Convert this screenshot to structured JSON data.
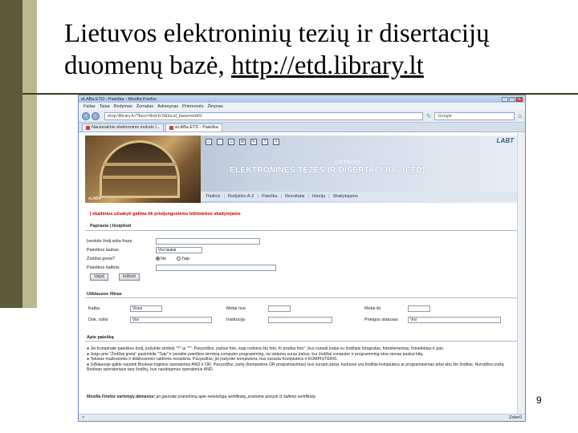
{
  "slide": {
    "title_line1": "Lietuvos elektroninių tezių ir disertacijų",
    "title_line2_prefix": "duomenų bazė, ",
    "title_url": "http://etd.library.lt",
    "page_number": "9"
  },
  "browser": {
    "window_title": "eLABa ETD - Paieška - Mozilla Firefox",
    "menu": [
      "Failas",
      "Taisa",
      "Rodymas",
      "Žurnalas",
      "Adresynas",
      "Priemonės",
      "Žinynas"
    ],
    "url": "etop:\\library.lt:/?func=find-b-0&local_base=etd01",
    "search_placeholder": "Google",
    "tabs": [
      {
        "label": "Nacionalinis elektroninis mokslo l...",
        "active": false
      },
      {
        "label": "eLABa ETD - Paieška",
        "active": true
      }
    ],
    "status_left": "×",
    "status_right": "Zoter0"
  },
  "site": {
    "photo_label": "eLABA",
    "logo": "LABT",
    "subtitle": "LIETUVOS",
    "title": "ELEKTRONINĖS TEZĖS IR DISERTACIJOS (ETD)",
    "nav": [
      "Titulinis",
      "Rodyklės A-Z",
      "Paieška",
      "Rezultatai",
      "Istorija",
      "Skaitytojams"
    ]
  },
  "content": {
    "notice": "Į skaitinius užsakyti galima tik prisijungusiems bibliotekos skaitytojams",
    "subtabs": "Paprasta | Išsiplėsti",
    "form": {
      "query_label": "Įveskite žodį arba frazę",
      "field_label": "Paieškos laukas",
      "field_value": "Visi laukai",
      "adjacent_label": "Žodžiai greta?",
      "radio_no": "Ne",
      "radio_yes": "Taip",
      "base_label": "Paieškos šaltinis",
      "btn_clear": "Valyti",
      "btn_search": "Ieškoti"
    },
    "filters": {
      "heading": "Užklausos filtras",
      "lang_label": "Kalba",
      "lang_value": "Visos",
      "year_from_label": "Metai nuo",
      "year_to_label": "Metai iki",
      "doctype_label": "Dok. rūšis",
      "doctype_value": "Visi",
      "institution_label": "Institucija",
      "status_label": "Prieigos statusas",
      "status_value": "Visi"
    },
    "help": {
      "heading": "Apie paiešką",
      "line1": "● Jei trumpinate paieškos žodį, įrašykite simbolį \"?\" ar \"*\". Pavyzdžiui, įrašius foto, kaip rodoma šių foto, fo prašbu foto\", bus surasti įrašai su žodžiais fotografas, fotoelementas, fotoefektas ir pan.",
      "line2": "● Jeigu prie \"Žodžiai greta\" pasirinkite \"Taip\" ir įveskite paieškos terminą computer programming, tai sistema suras įrašus, kur žodžiai computer ir programming eina vienas paskui kitą.",
      "line3": "● Tekstas mažosiomis ir didžiosiomis raidėmis nesiskiria. Pavyzdžiui, jei įrašysite kompiutera, bus surasta Kompiutera ir KOMPIUTERIS.",
      "line4": "● Užklausoje galite naudoti Boolean loginius operatorius AND ir OR. Pavyzdžiui, įrašę (kompiutera OR programavimas) bus surasti įrašai, kuriuose yra žodžiai kompiutera ar programavimas arba abu šie žodžiai. Nurodžius įrašą Boolean operatoriaus tarp žodžių, bus naudojamas operatorius AND.",
      "mozilla_prefix": "Mozilla Firefox vartotojų dėmesiui:",
      "mozilla_text": " jei gaunate pranešimą apie neteisingą sertifikatą, prašome atsiųsti iš šaltinio sertifikatą"
    }
  }
}
